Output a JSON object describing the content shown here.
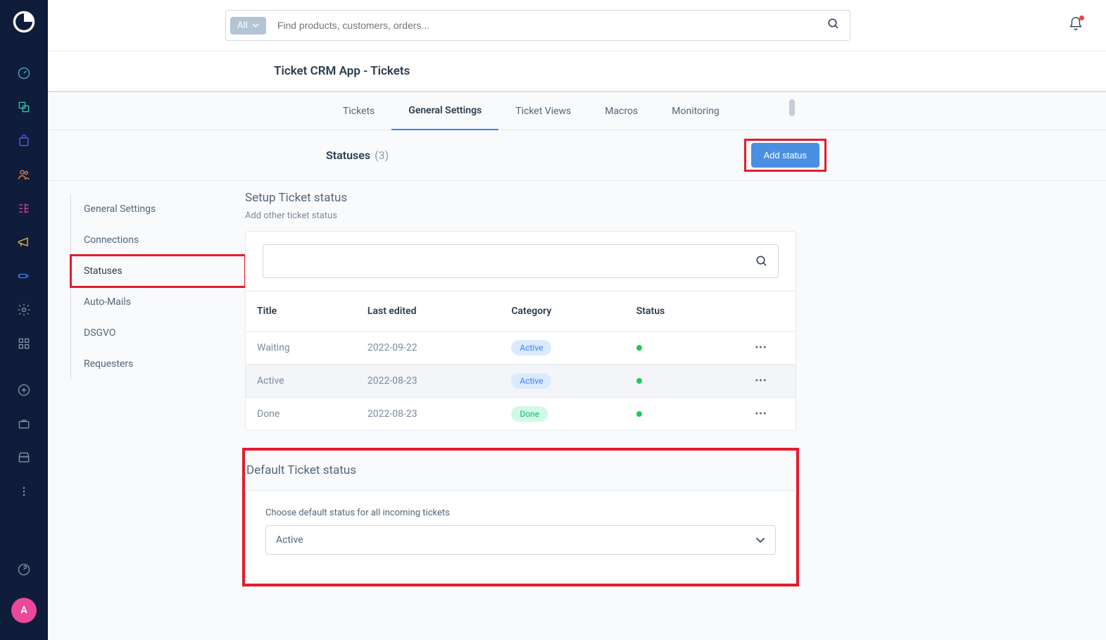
{
  "search": {
    "filter_label": "All",
    "placeholder": "Find products, customers, orders..."
  },
  "page_title": "Ticket CRM App - Tickets",
  "tabs": [
    "Tickets",
    "General Settings",
    "Ticket Views",
    "Macros",
    "Monitoring"
  ],
  "active_tab": 1,
  "subhead": {
    "title": "Statuses",
    "count": "(3)",
    "add_label": "Add status"
  },
  "side_nav": [
    "General Settings",
    "Connections",
    "Statuses",
    "Auto-Mails",
    "DSGVO",
    "Requesters"
  ],
  "side_nav_active": 2,
  "section": {
    "title": "Setup Ticket status",
    "subtitle": "Add other ticket status"
  },
  "table": {
    "headers": [
      "Title",
      "Last edited",
      "Category",
      "Status",
      ""
    ],
    "rows": [
      {
        "title": "Waiting",
        "edited": "2022-09-22",
        "category": "Active",
        "cat_style": "blue",
        "status": "green"
      },
      {
        "title": "Active",
        "edited": "2022-08-23",
        "category": "Active",
        "cat_style": "blue",
        "status": "green",
        "hover": true
      },
      {
        "title": "Done",
        "edited": "2022-08-23",
        "category": "Done",
        "cat_style": "green",
        "status": "green"
      }
    ]
  },
  "default_section": {
    "title": "Default Ticket status",
    "label": "Choose default status for all incoming tickets",
    "value": "Active"
  },
  "avatar": "A"
}
